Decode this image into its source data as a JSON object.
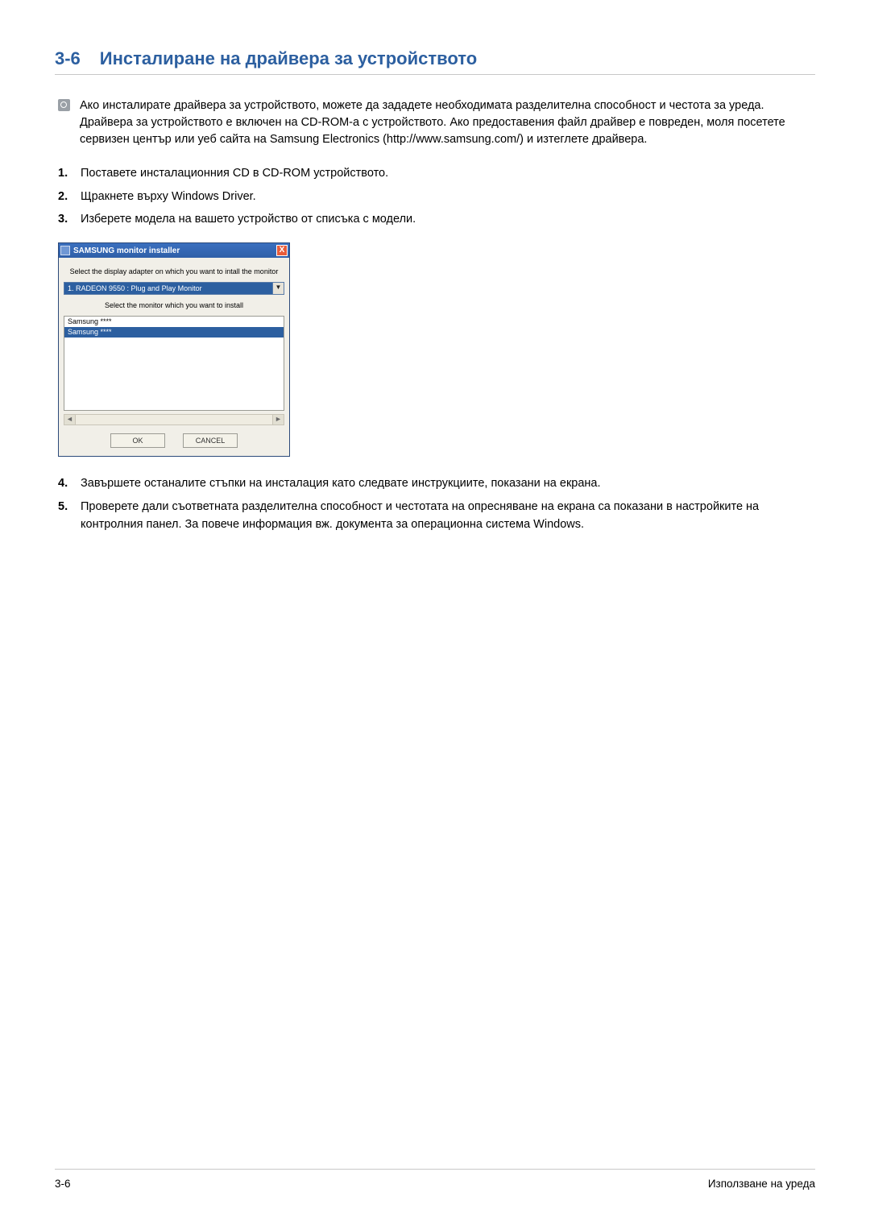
{
  "heading": {
    "number": "3-6",
    "title": "Инсталиране на драйвера за устройството"
  },
  "note": "Ако инсталирате драйвера за устройството, можете да зададете необходимата разделителна способност и честота за уреда. Драйвера за устройството е включен на CD-ROM-а с устройството. Ако предоставения файл драйвер е повреден, моля посетете сервизен център или уеб сайта на Samsung Electronics (http://www.samsung.com/) и изтеглете драйвера.",
  "steps": {
    "s1": "Поставете инсталационния CD в CD-ROM устройството.",
    "s2": "Щракнете върху Windows Driver.",
    "s3": "Изберете модела на вашето устройство от списъка с модели.",
    "s4": "Завършете останалите стъпки на инсталация като следвате инструкциите, показани на екрана.",
    "s5": "Проверете дали съответната разделителна способност и честотата на опресняване на екрана са показани в настройките на контролния панел. За повече информация вж. документа за операционна система Windows."
  },
  "installer": {
    "title": "SAMSUNG monitor installer",
    "label1": "Select the display adapter on which you want to intall the monitor",
    "combo_value": "1. RADEON 9550 : Plug and Play Monitor",
    "label2": "Select the monitor which you want to install",
    "list_item1": "Samsung ****",
    "list_item2": "Samsung ****",
    "ok": "OK",
    "cancel": "CANCEL",
    "close": "X"
  },
  "footer": {
    "left": "3-6",
    "right": "Използване на уреда"
  }
}
